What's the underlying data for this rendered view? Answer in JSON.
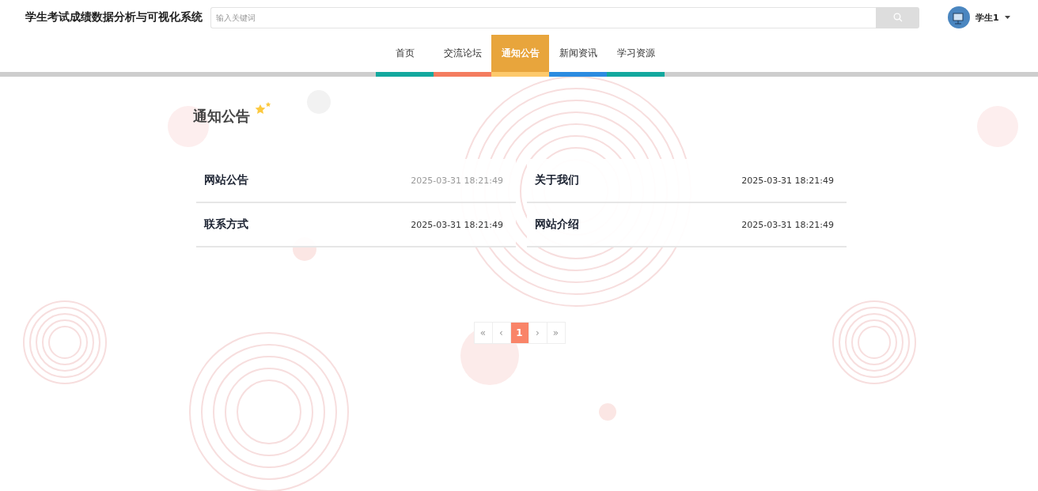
{
  "header": {
    "title": "学生考试成绩数据分析与可视化系统",
    "search": {
      "placeholder": "输入关键词"
    },
    "user": {
      "name": "学生1"
    }
  },
  "nav": [
    {
      "label": "首页",
      "selected": false,
      "color": "#13a89e"
    },
    {
      "label": "交流论坛",
      "selected": false,
      "color": "#f47c5f"
    },
    {
      "label": "通知公告",
      "selected": true,
      "color": "#fdc96b"
    },
    {
      "label": "新闻资讯",
      "selected": false,
      "color": "#2b8be0"
    },
    {
      "label": "学习资源",
      "selected": false,
      "color": "#13a89e"
    }
  ],
  "section": {
    "title": "通知公告"
  },
  "notices": [
    {
      "title": "网站公告",
      "date": "2025-03-31 18:21:49",
      "hovered": true
    },
    {
      "title": "关于我们",
      "date": "2025-03-31 18:21:49",
      "hovered": false
    },
    {
      "title": "联系方式",
      "date": "2025-03-31 18:21:49",
      "hovered": false
    },
    {
      "title": "网站介绍",
      "date": "2025-03-31 18:21:49",
      "hovered": false
    }
  ],
  "pagination": [
    {
      "label": "«",
      "selected": false
    },
    {
      "label": "‹",
      "selected": false
    },
    {
      "label": "1",
      "selected": true
    },
    {
      "label": "›",
      "selected": false
    },
    {
      "label": "»",
      "selected": false
    }
  ]
}
